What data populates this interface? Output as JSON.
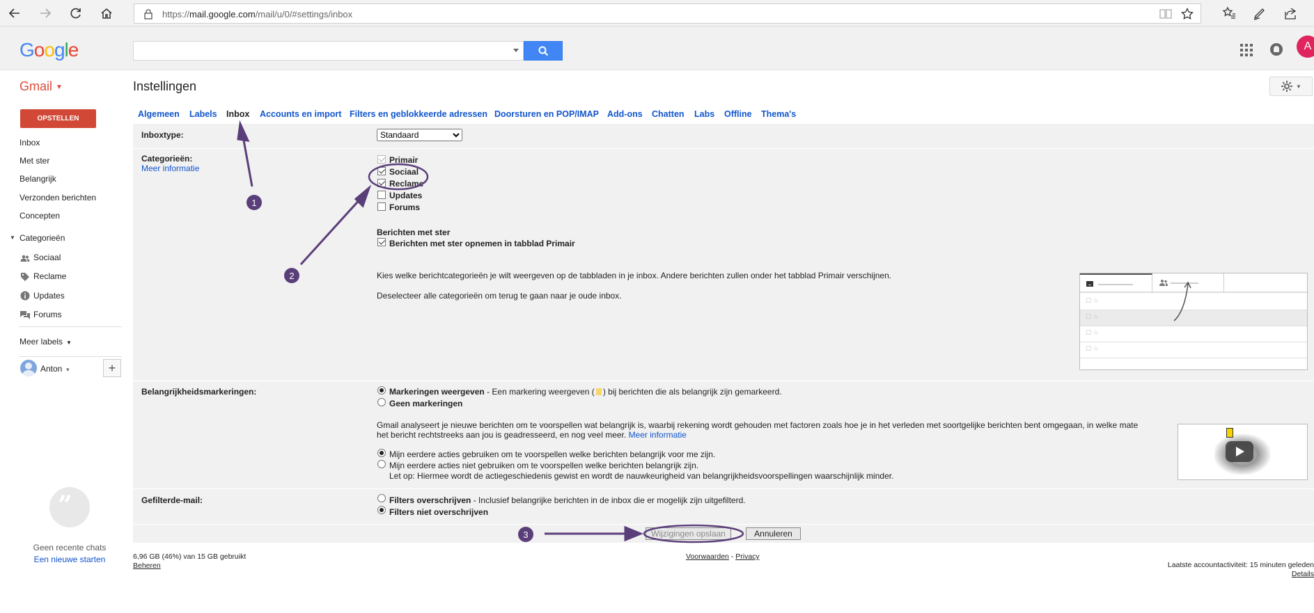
{
  "browser": {
    "url_prefix": "https://",
    "url_host": "mail.google.com",
    "url_path": "/mail/u/0/#settings/inbox"
  },
  "header": {
    "logo": "Google",
    "avatar_letter": "A"
  },
  "app": {
    "name": "Gmail",
    "page_title": "Instellingen"
  },
  "sidebar": {
    "compose": "OPSTELLEN",
    "items": [
      "Inbox",
      "Met ster",
      "Belangrijk",
      "Verzonden berichten",
      "Concepten"
    ],
    "categories_label": "Categorieën",
    "categories": [
      "Sociaal",
      "Reclame",
      "Updates",
      "Forums"
    ],
    "more_labels": "Meer labels",
    "user": "Anton",
    "hangouts_none": "Geen recente chats",
    "hangouts_start": "Een nieuwe starten"
  },
  "tabs": [
    "Algemeen",
    "Labels",
    "Inbox",
    "Accounts en import",
    "Filters en geblokkeerde adressen",
    "Doorsturen en POP/IMAP",
    "Add-ons",
    "Chatten",
    "Labs",
    "Offline",
    "Thema's"
  ],
  "settings": {
    "inbox_type_label": "Inboxtype:",
    "inbox_type_value": "Standaard",
    "categories_label": "Categorieën:",
    "more_info": "Meer informatie",
    "categories": [
      {
        "label": "Primair",
        "checked": true,
        "disabled": true
      },
      {
        "label": "Sociaal",
        "checked": true
      },
      {
        "label": "Reclame",
        "checked": true
      },
      {
        "label": "Updates",
        "checked": false
      },
      {
        "label": "Forums",
        "checked": false
      }
    ],
    "starred_heading": "Berichten met ster",
    "starred_option": "Berichten met ster opnemen in tabblad Primair",
    "cat_desc1": "Kies welke berichtcategorieën je wilt weergeven op de tabbladen in je inbox. Andere berichten zullen onder het tabblad Primair verschijnen.",
    "cat_desc2": "Deselecteer alle categorieën om terug te gaan naar je oude inbox.",
    "importance_label": "Belangrijkheidsmarkeringen:",
    "imp_show": "Markeringen weergeven",
    "imp_show_desc_a": " - Een markering weergeven (",
    "imp_show_desc_b": ") bij berichten die als belangrijk zijn gemarkeerd.",
    "imp_none": "Geen markeringen",
    "imp_desc1": "Gmail analyseert je nieuwe berichten om te voorspellen wat belangrijk is, waarbij rekening wordt gehouden met factoren zoals hoe je in het verleden met soortgelijke berichten bent omgegaan, in welke mate",
    "imp_desc2": "het bericht rechtstreeks aan jou is geadresseerd, en nog veel meer.",
    "imp_more": "Meer informatie",
    "imp_use": "Mijn eerdere acties gebruiken om te voorspellen welke berichten belangrijk voor me zijn.",
    "imp_nouse": "Mijn eerdere acties niet gebruiken om te voorspellen welke berichten belangrijk zijn.",
    "imp_note": "Let op: Hiermee wordt de actiegeschiedenis gewist en wordt de nauwkeurigheid van belangrijkheidsvoorspellingen waarschijnlijk minder.",
    "filtered_label": "Gefilterde-mail:",
    "filter_override": "Filters overschrijven",
    "filter_override_desc": " - Inclusief belangrijke berichten in de inbox die er mogelijk zijn uitgefilterd.",
    "filter_no_override": "Filters niet overschrijven",
    "save": "Wijzigingen opslaan",
    "cancel": "Annuleren"
  },
  "annotations": [
    "1",
    "2",
    "3"
  ],
  "footer": {
    "storage": "6,96 GB (46%) van 15 GB gebruikt",
    "manage": "Beheren",
    "terms": "Voorwaarden",
    "dash": " - ",
    "privacy": "Privacy",
    "activity": "Laatste accountactiviteit: 15 minuten geleden",
    "details": "Details"
  }
}
